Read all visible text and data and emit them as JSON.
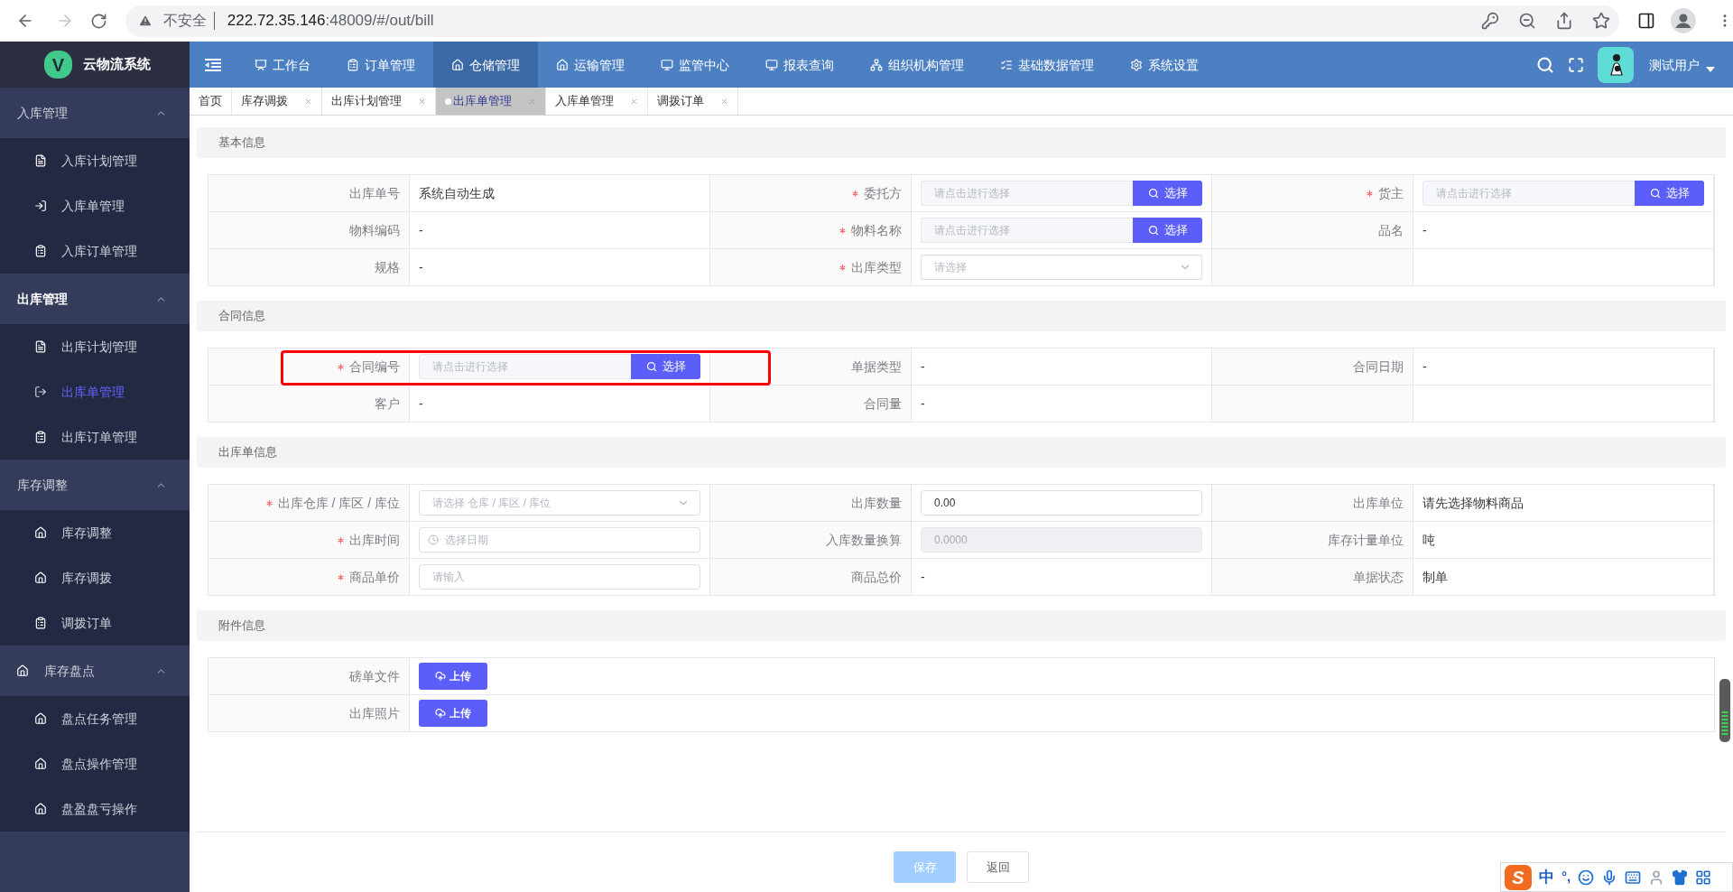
{
  "browser": {
    "security_label": "不安全",
    "url_host": "222.72.35.146",
    "url_path": ":48009/#/out/bill"
  },
  "app": {
    "logo_letter": "V",
    "name": "云物流系统"
  },
  "top_nav": [
    {
      "label": "工作台",
      "selected": false
    },
    {
      "label": "订单管理",
      "selected": false
    },
    {
      "label": "仓储管理",
      "selected": true
    },
    {
      "label": "运输管理",
      "selected": false
    },
    {
      "label": "监管中心",
      "selected": false
    },
    {
      "label": "报表查询",
      "selected": false
    },
    {
      "label": "组织机构管理",
      "selected": false
    },
    {
      "label": "基础数据管理",
      "selected": false
    },
    {
      "label": "系统设置",
      "selected": false
    }
  ],
  "user": {
    "name": "测试用户"
  },
  "tabs": [
    {
      "label": "首页",
      "selected": false,
      "closable": false
    },
    {
      "label": "库存调拨",
      "selected": false,
      "closable": true
    },
    {
      "label": "出库计划管理",
      "selected": false,
      "closable": true
    },
    {
      "label": "出库单管理",
      "selected": true,
      "closable": true
    },
    {
      "label": "入库单管理",
      "selected": false,
      "closable": true
    },
    {
      "label": "调拨订单",
      "selected": false,
      "closable": true
    }
  ],
  "sidebar": [
    {
      "label": "入库管理",
      "active": false,
      "expanded": true,
      "children": [
        {
          "label": "入库计划管理",
          "selected": false
        },
        {
          "label": "入库单管理",
          "selected": false
        },
        {
          "label": "入库订单管理",
          "selected": false
        }
      ]
    },
    {
      "label": "出库管理",
      "active": true,
      "expanded": true,
      "children": [
        {
          "label": "出库计划管理",
          "selected": false
        },
        {
          "label": "出库单管理",
          "selected": true
        },
        {
          "label": "出库订单管理",
          "selected": false
        }
      ]
    },
    {
      "label": "库存调整",
      "active": false,
      "expanded": true,
      "children": [
        {
          "label": "库存调整",
          "selected": false
        },
        {
          "label": "库存调拨",
          "selected": false
        },
        {
          "label": "调拨订单",
          "selected": false
        }
      ]
    },
    {
      "label": "库存盘点",
      "active": false,
      "expanded": true,
      "children": [
        {
          "label": "盘点任务管理",
          "selected": false
        },
        {
          "label": "盘点操作管理",
          "selected": false
        },
        {
          "label": "盘盈盘亏操作",
          "selected": false
        }
      ]
    }
  ],
  "sections": [
    {
      "title": "基本信息",
      "rows": [
        {
          "cells": [
            {
              "label": "出库单号",
              "required": false,
              "highlighted": false,
              "kind": "text",
              "value": "系统自动生成"
            },
            {
              "label": "委托方",
              "required": true,
              "highlighted": false,
              "kind": "picker",
              "placeholder": "请点击进行选择",
              "button": "选择"
            },
            {
              "label": "货主",
              "required": true,
              "highlighted": false,
              "kind": "picker",
              "placeholder": "请点击进行选择",
              "button": "选择"
            }
          ]
        },
        {
          "cells": [
            {
              "label": "物料编码",
              "required": false,
              "highlighted": false,
              "kind": "text",
              "value": "-"
            },
            {
              "label": "物料名称",
              "required": true,
              "highlighted": false,
              "kind": "picker",
              "placeholder": "请点击进行选择",
              "button": "选择"
            },
            {
              "label": "品名",
              "required": false,
              "highlighted": false,
              "kind": "text",
              "value": "-"
            }
          ]
        },
        {
          "cells": [
            {
              "label": "规格",
              "required": false,
              "highlighted": false,
              "kind": "text",
              "value": "-"
            },
            {
              "label": "出库类型",
              "required": true,
              "highlighted": false,
              "kind": "select",
              "placeholder": "请选择"
            },
            {
              "kind": "empty"
            }
          ]
        }
      ]
    },
    {
      "title": "合同信息",
      "rows": [
        {
          "cells": [
            {
              "label": "合同编号",
              "required": true,
              "highlighted": true,
              "kind": "picker",
              "placeholder": "请点击进行选择",
              "button": "选择"
            },
            {
              "label": "单据类型",
              "required": false,
              "highlighted": false,
              "kind": "text",
              "value": "-"
            },
            {
              "label": "合同日期",
              "required": false,
              "highlighted": false,
              "kind": "text",
              "value": "-"
            }
          ]
        },
        {
          "cells": [
            {
              "label": "客户",
              "required": false,
              "highlighted": false,
              "kind": "text",
              "value": "-"
            },
            {
              "label": "合同量",
              "required": false,
              "highlighted": false,
              "kind": "text",
              "value": "-"
            },
            {
              "kind": "empty"
            }
          ]
        }
      ]
    },
    {
      "title": "出库单信息",
      "rows": [
        {
          "cells": [
            {
              "label": "出库仓库 / 库区 / 库位",
              "required": true,
              "highlighted": false,
              "kind": "select",
              "placeholder": "请选择 仓库 / 库区 / 库位"
            },
            {
              "label": "出库数量",
              "required": false,
              "highlighted": false,
              "kind": "input",
              "value": "0.00",
              "disabled": false
            },
            {
              "label": "出库单位",
              "required": false,
              "highlighted": false,
              "kind": "text",
              "value": "请先选择物料商品"
            }
          ]
        },
        {
          "cells": [
            {
              "label": "出库时间",
              "required": true,
              "highlighted": false,
              "kind": "date",
              "placeholder": "选择日期"
            },
            {
              "label": "入库数量换算",
              "required": false,
              "highlighted": false,
              "kind": "input",
              "value": "0.0000",
              "disabled": true
            },
            {
              "label": "库存计量单位",
              "required": false,
              "highlighted": false,
              "kind": "text",
              "value": "吨"
            }
          ]
        },
        {
          "cells": [
            {
              "label": "商品单价",
              "required": true,
              "highlighted": false,
              "kind": "input",
              "placeholder": "请输入",
              "disabled": false
            },
            {
              "label": "商品总价",
              "required": false,
              "highlighted": false,
              "kind": "text",
              "value": "-"
            },
            {
              "label": "单据状态",
              "required": false,
              "highlighted": false,
              "kind": "text",
              "value": "制单"
            }
          ]
        }
      ]
    },
    {
      "title": "附件信息",
      "rows": [
        {
          "cells": [
            {
              "label": "磅单文件",
              "required": false,
              "highlighted": false,
              "kind": "upload",
              "button": "上传"
            }
          ]
        },
        {
          "cells": [
            {
              "label": "出库照片",
              "required": false,
              "highlighted": false,
              "kind": "upload",
              "button": "上传"
            }
          ]
        }
      ]
    }
  ],
  "footer_buttons": [
    {
      "label": "保存",
      "kind": "primary",
      "disabled": true
    },
    {
      "label": "返回",
      "kind": "default",
      "disabled": false
    }
  ],
  "ime_bar": {
    "logo_letter": "S",
    "mode": "中",
    "punctuation": "°,"
  }
}
